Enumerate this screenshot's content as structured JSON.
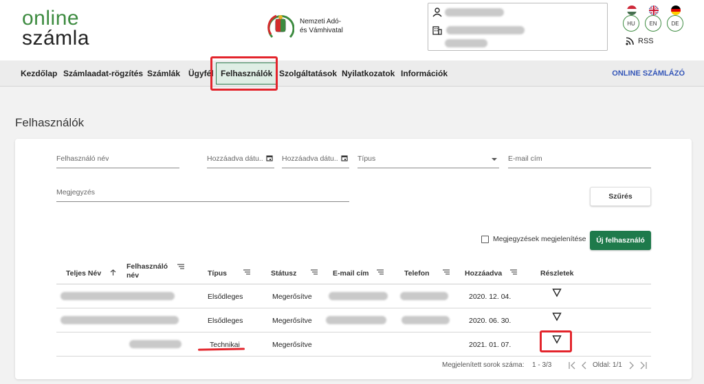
{
  "brand": {
    "line1": "online",
    "line2": "számla"
  },
  "agency": {
    "line1": "Nemzeti Adó-",
    "line2": "és Vámhivatal"
  },
  "languages": [
    "HU",
    "EN",
    "DE"
  ],
  "rss_label": "RSS",
  "nav": {
    "items": [
      "Kezdőlap",
      "Számlaadat-rögzítés",
      "Számlák",
      "Ügyfél",
      "Felhasználók",
      "Szolgáltatások",
      "Nyilatkozatok",
      "Információk"
    ],
    "active": "Felhasználók",
    "right_link": "ONLINE SZÁMLÁZÓ"
  },
  "page_title": "Felhasználók",
  "filters": {
    "username": "Felhasználó név",
    "added_from": "Hozzáadva dátu...",
    "added_to": "Hozzáadva dátu...",
    "type": "Típus",
    "email": "E-mail cím",
    "note": "Megjegyzés",
    "filter_button": "Szűrés"
  },
  "show_notes_label": "Megjegyzések megjelenítése",
  "new_user_button": "Új felhasználó",
  "table": {
    "headers": [
      "Teljes Név",
      "Felhasználó név",
      "Típus",
      "Státusz",
      "E-mail cím",
      "Telefon",
      "Hozzáadva",
      "Részletek"
    ],
    "header_user_line1": "Felhasználó",
    "header_user_line2": "név",
    "rows": [
      {
        "type": "Elsődleges",
        "status": "Megerősítve",
        "added": "2020. 12. 04."
      },
      {
        "type": "Elsődleges",
        "status": "Megerősítve",
        "added": "2020. 06. 30."
      },
      {
        "type": "Technikai",
        "status": "Megerősítve",
        "added": "2021. 01. 07."
      }
    ]
  },
  "pagination": {
    "rows_label": "Megjelenített sorok száma:",
    "range": "1 - 3/3",
    "page_label": "Oldal: 1/1"
  },
  "colors": {
    "brand_green": "#3d8b40",
    "button_green": "#1e7a4b",
    "highlight_red": "#e3242b",
    "link_blue": "#3456b8"
  }
}
